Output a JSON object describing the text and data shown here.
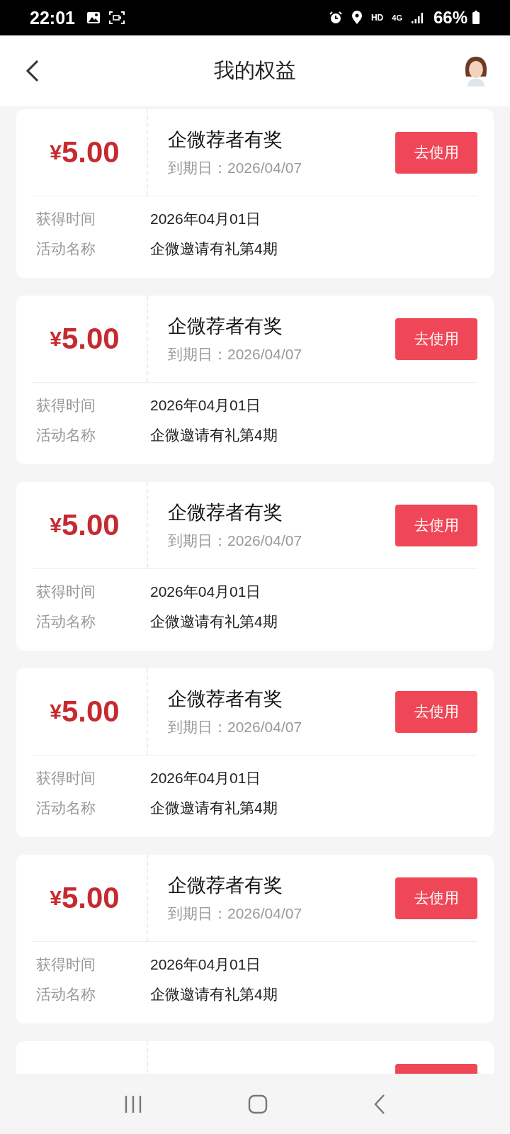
{
  "status_bar": {
    "time": "22:01",
    "hd": "HD",
    "network": "4G",
    "battery": "66%"
  },
  "header": {
    "title": "我的权益"
  },
  "coupons": [
    {
      "kind": "full",
      "currency": "¥",
      "amount": "5.00",
      "title": "企微荐者有奖",
      "expiry": "到期日：2026/04/07",
      "button": "去使用",
      "fields": [
        {
          "label": "获得时间",
          "value": "2026年04月01日"
        },
        {
          "label": "活动名称",
          "value": "企微邀请有礼第4期"
        }
      ]
    },
    {
      "kind": "full",
      "currency": "¥",
      "amount": "5.00",
      "title": "企微荐者有奖",
      "expiry": "到期日：2026/04/07",
      "button": "去使用",
      "fields": [
        {
          "label": "获得时间",
          "value": "2026年04月01日"
        },
        {
          "label": "活动名称",
          "value": "企微邀请有礼第4期"
        }
      ]
    },
    {
      "kind": "full",
      "currency": "¥",
      "amount": "5.00",
      "title": "企微荐者有奖",
      "expiry": "到期日：2026/04/07",
      "button": "去使用",
      "fields": [
        {
          "label": "获得时间",
          "value": "2026年04月01日"
        },
        {
          "label": "活动名称",
          "value": "企微邀请有礼第4期"
        }
      ]
    },
    {
      "kind": "full",
      "currency": "¥",
      "amount": "5.00",
      "title": "企微荐者有奖",
      "expiry": "到期日：2026/04/07",
      "button": "去使用",
      "fields": [
        {
          "label": "获得时间",
          "value": "2026年04月01日"
        },
        {
          "label": "活动名称",
          "value": "企微邀请有礼第4期"
        }
      ]
    },
    {
      "kind": "full",
      "currency": "¥",
      "amount": "5.00",
      "title": "企微荐者有奖",
      "expiry": "到期日：2026/04/07",
      "button": "去使用",
      "fields": [
        {
          "label": "获得时间",
          "value": "2026年04月01日"
        },
        {
          "label": "活动名称",
          "value": "企微邀请有礼第4期"
        }
      ]
    },
    {
      "kind": "partial"
    }
  ]
}
